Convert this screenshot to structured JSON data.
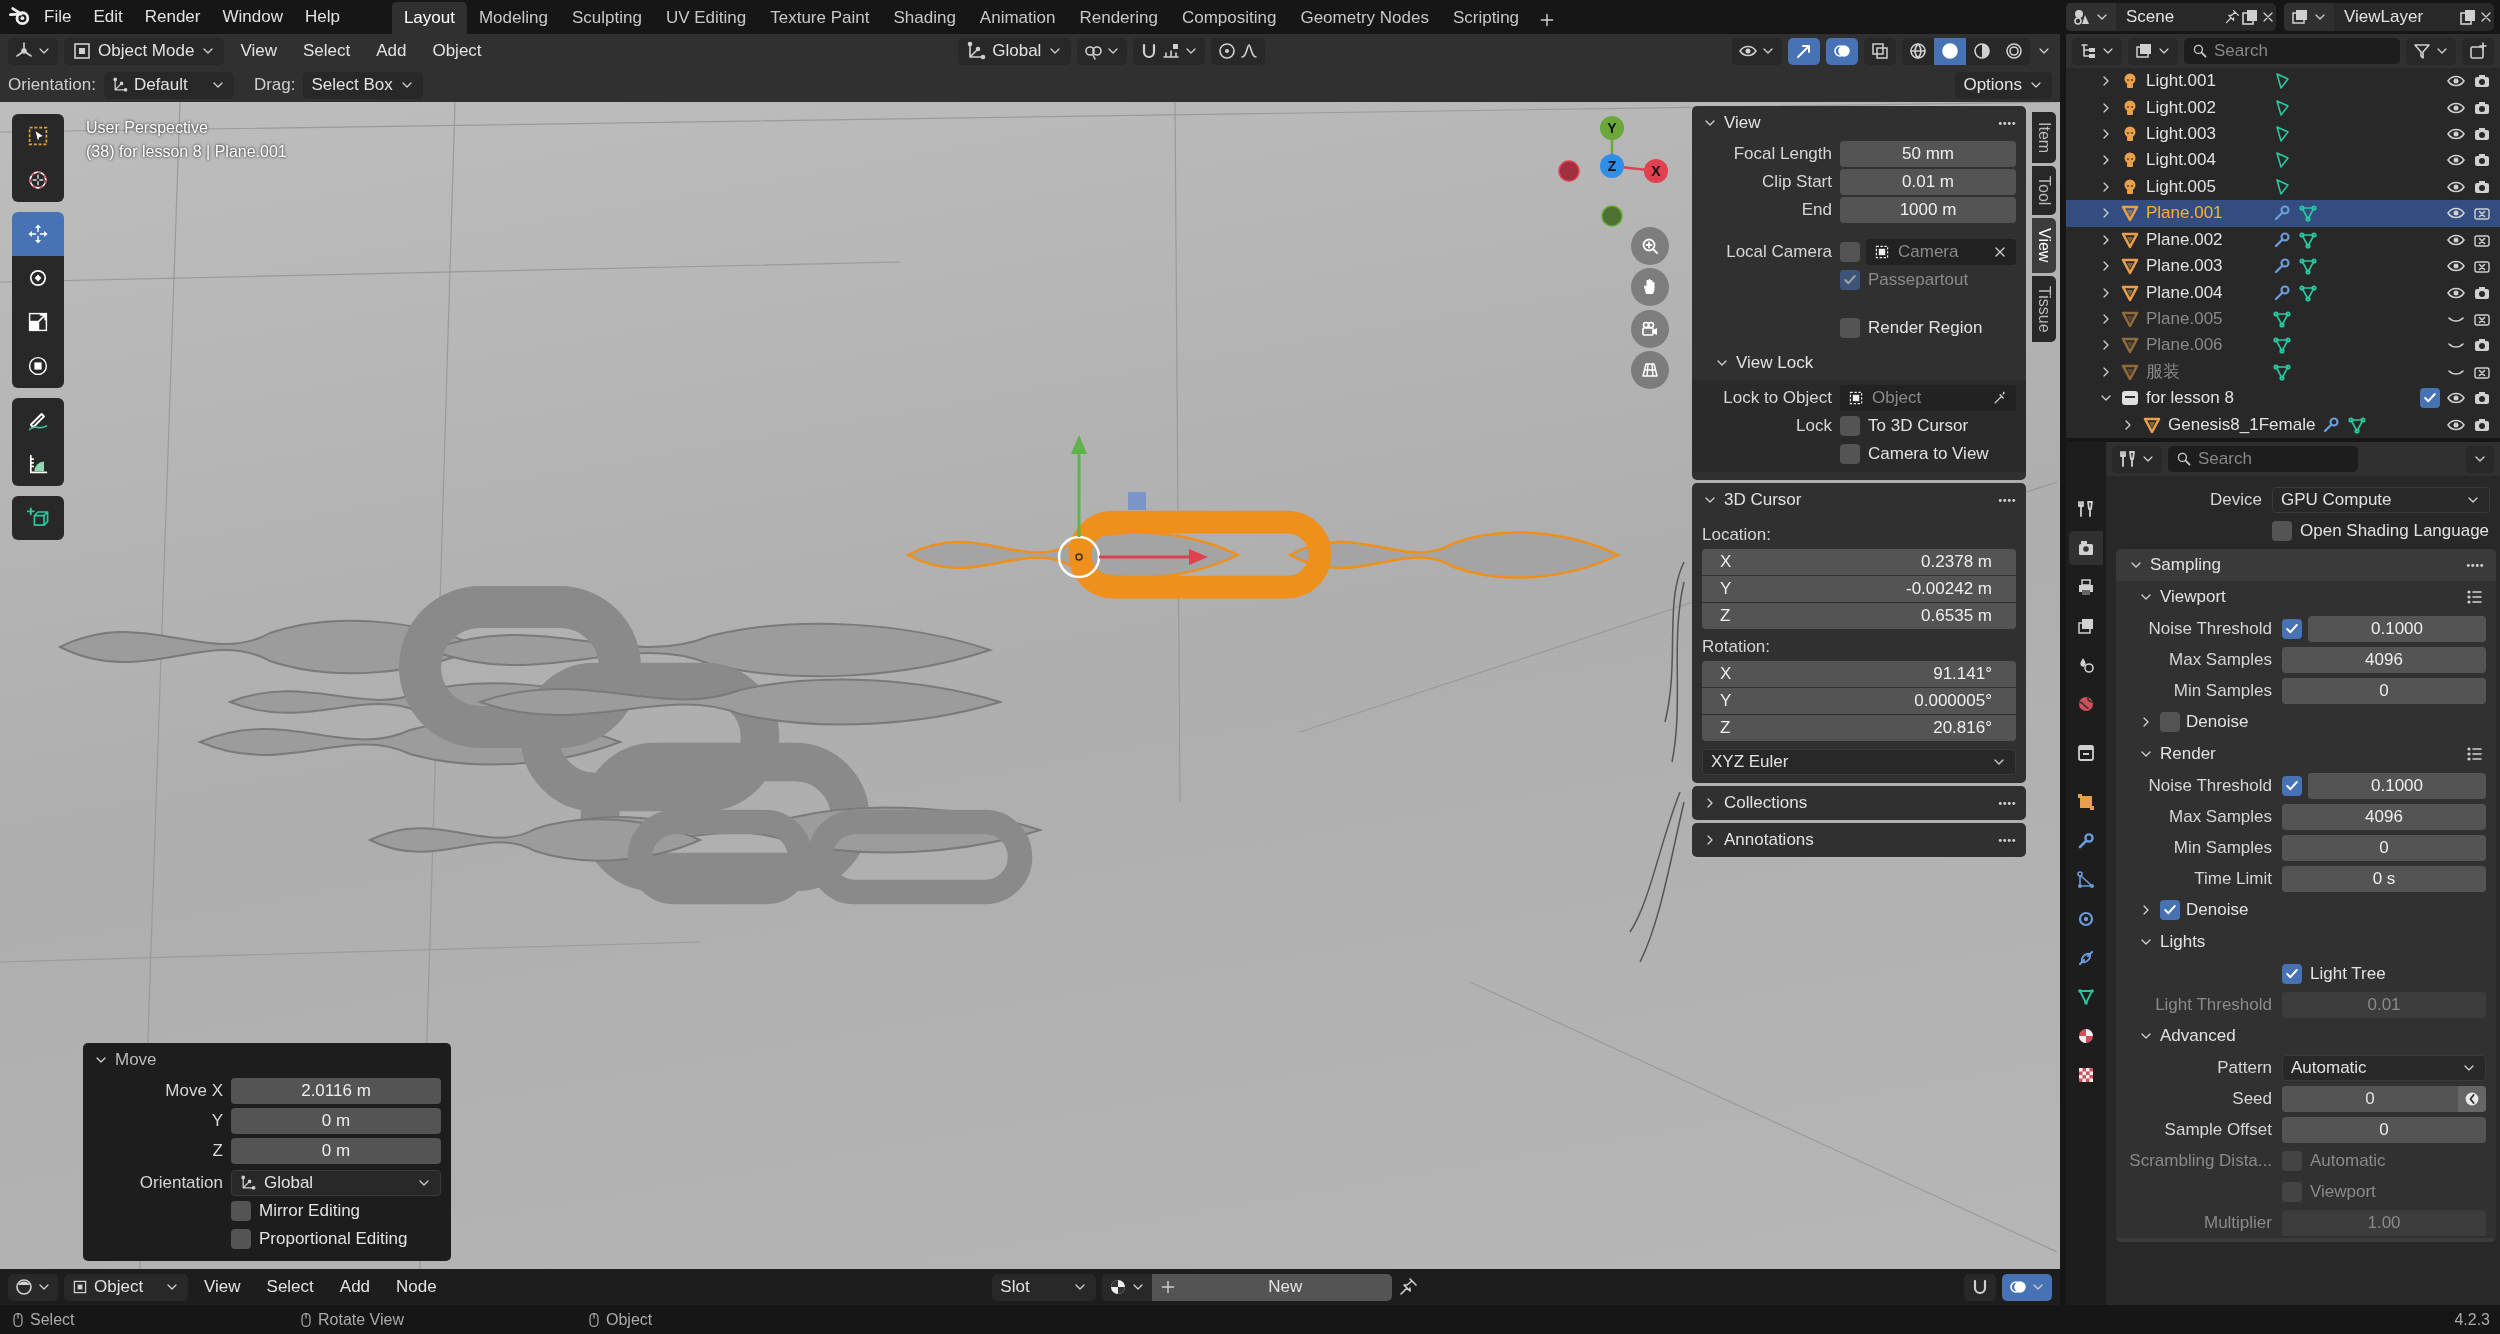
{
  "menu": [
    "File",
    "Edit",
    "Render",
    "Window",
    "Help"
  ],
  "workspaces": [
    {
      "label": "Layout",
      "selected": true
    },
    {
      "label": "Modeling",
      "selected": false
    },
    {
      "label": "Sculpting",
      "selected": false
    },
    {
      "label": "UV Editing",
      "selected": false
    },
    {
      "label": "Texture Paint",
      "selected": false
    },
    {
      "label": "Shading",
      "selected": false
    },
    {
      "label": "Animation",
      "selected": false
    },
    {
      "label": "Rendering",
      "selected": false
    },
    {
      "label": "Compositing",
      "selected": false
    },
    {
      "label": "Geometry Nodes",
      "selected": false
    },
    {
      "label": "Scripting",
      "selected": false
    }
  ],
  "scene": "Scene",
  "view_layer": "ViewLayer",
  "viewport_header": {
    "mode": "Object Mode",
    "menus": [
      "View",
      "Select",
      "Add",
      "Object"
    ],
    "orientation": "Global",
    "toggles": [
      {
        "kind": "gizmo",
        "on": true
      },
      {
        "kind": "overlay",
        "on": true
      },
      {
        "kind": "xray",
        "on": false
      }
    ],
    "shading": [
      {
        "kind": "wireframe",
        "selected": false
      },
      {
        "kind": "solid",
        "selected": true
      },
      {
        "kind": "material",
        "selected": false
      },
      {
        "kind": "rendered",
        "selected": false
      }
    ]
  },
  "tool_settings": {
    "orientation_label": "Orientation:",
    "orientation": "Default",
    "drag_label": "Drag:",
    "drag": "Select Box",
    "options": "Options"
  },
  "tools": [
    {
      "kind": "select_box",
      "selected": false
    },
    {
      "kind": "cursor",
      "selected": false
    },
    {
      "kind": "move",
      "selected": true
    },
    {
      "kind": "rotate",
      "selected": false
    },
    {
      "kind": "scale",
      "selected": false
    },
    {
      "kind": "transform",
      "selected": false
    },
    {
      "kind": "annotate",
      "selected": false
    },
    {
      "kind": "measure",
      "selected": false
    },
    {
      "kind": "add_cube",
      "selected": false
    }
  ],
  "viewport_info": [
    "User Perspective",
    "(38) for lesson 8 | Plane.001"
  ],
  "gizmo_axes": {
    "x": "X",
    "y": "Y",
    "z": "Z"
  },
  "sidebar_tabs": [
    {
      "label": "Item",
      "selected": false
    },
    {
      "label": "Tool",
      "selected": false
    },
    {
      "label": "View",
      "selected": true
    },
    {
      "label": "Tissue",
      "selected": false
    }
  ],
  "view_panel": {
    "title": "View",
    "fields": [
      {
        "label": "Focal Length",
        "value": "50 mm"
      },
      {
        "label": "Clip Start",
        "value": "0.01 m"
      },
      {
        "label": "End",
        "value": "1000 m"
      }
    ],
    "local_camera": {
      "label": "Local Camera",
      "checked": false,
      "placeholder": "Camera"
    },
    "passepartout": {
      "label": "Passepartout",
      "checked": true
    },
    "render_region": {
      "label": "Render Region",
      "checked": false
    },
    "view_lock": {
      "title": "View Lock",
      "lock_to_object_label": "Lock to Object",
      "lock_to_object_placeholder": "Object",
      "lock_label": "Lock",
      "options": [
        {
          "label": "To 3D Cursor",
          "checked": false
        },
        {
          "label": "Camera to View",
          "checked": false
        }
      ]
    }
  },
  "cursor_panel": {
    "title": "3D Cursor",
    "location_label": "Location:",
    "location": [
      {
        "axis": "X",
        "value": "0.2378 m"
      },
      {
        "axis": "Y",
        "value": "-0.00242 m"
      },
      {
        "axis": "Z",
        "value": "0.6535 m"
      }
    ],
    "rotation_label": "Rotation:",
    "rotation": [
      {
        "axis": "X",
        "value": "91.141°"
      },
      {
        "axis": "Y",
        "value": "0.000005°"
      },
      {
        "axis": "Z",
        "value": "20.816°"
      }
    ],
    "rotation_mode": "XYZ Euler"
  },
  "collapsed_panels": [
    "Collections",
    "Annotations"
  ],
  "redo_panel": {
    "title": "Move",
    "fields": [
      {
        "label": "Move X",
        "value": "2.0116 m"
      },
      {
        "label": "Y",
        "value": "0 m"
      },
      {
        "label": "Z",
        "value": "0 m"
      }
    ],
    "orientation_label": "Orientation",
    "orientation": "Global",
    "options": [
      {
        "label": "Mirror Editing",
        "checked": false
      },
      {
        "label": "Proportional Editing",
        "checked": false
      }
    ]
  },
  "editor_header": {
    "mode": "Object",
    "menus": [
      "View",
      "Select",
      "Add",
      "Node"
    ],
    "slot": "Slot",
    "new_button": "New",
    "overlay_on": true
  },
  "outliner": {
    "search_placeholder": "Search",
    "items": [
      {
        "name": "Light.001",
        "kind": "light",
        "expanded": false,
        "selected": false,
        "visible": true,
        "renderable": true,
        "modifier": false
      },
      {
        "name": "Light.002",
        "kind": "light",
        "expanded": false,
        "selected": false,
        "visible": true,
        "renderable": true,
        "modifier": false
      },
      {
        "name": "Light.003",
        "kind": "light",
        "expanded": false,
        "selected": false,
        "visible": true,
        "renderable": true,
        "modifier": false
      },
      {
        "name": "Light.004",
        "kind": "light",
        "expanded": false,
        "selected": false,
        "visible": true,
        "renderable": true,
        "modifier": false
      },
      {
        "name": "Light.005",
        "kind": "light",
        "expanded": false,
        "selected": false,
        "visible": true,
        "renderable": true,
        "modifier": false
      },
      {
        "name": "Plane.001",
        "kind": "mesh",
        "expanded": false,
        "selected": true,
        "visible": true,
        "renderable": false,
        "modifier": true
      },
      {
        "name": "Plane.002",
        "kind": "mesh",
        "expanded": false,
        "selected": false,
        "visible": true,
        "renderable": false,
        "modifier": true
      },
      {
        "name": "Plane.003",
        "kind": "mesh",
        "expanded": false,
        "selected": false,
        "visible": true,
        "renderable": false,
        "modifier": true
      },
      {
        "name": "Plane.004",
        "kind": "mesh",
        "expanded": false,
        "selected": false,
        "visible": true,
        "renderable": true,
        "modifier": true
      },
      {
        "name": "Plane.005",
        "kind": "mesh",
        "expanded": false,
        "selected": false,
        "visible": false,
        "renderable": false,
        "modifier": false
      },
      {
        "name": "Plane.006",
        "kind": "mesh",
        "expanded": false,
        "selected": false,
        "visible": false,
        "renderable": true,
        "modifier": false
      },
      {
        "name": "服装",
        "kind": "mesh",
        "expanded": false,
        "selected": false,
        "visible": false,
        "renderable": false,
        "modifier": false
      },
      {
        "name": "for lesson 8",
        "kind": "collection",
        "expanded": true,
        "selected": false,
        "visible": true,
        "renderable": true,
        "modifier": false,
        "checked": true,
        "children": [
          {
            "name": "Genesis8_1Female",
            "kind": "mesh",
            "expanded": false,
            "selected": false,
            "visible": true,
            "renderable": true,
            "modifier": true
          }
        ]
      }
    ]
  },
  "properties": {
    "search_placeholder": "Search",
    "tabs": [
      {
        "kind": "tool",
        "selected": false
      },
      {
        "kind": "render",
        "selected": true
      },
      {
        "kind": "output",
        "selected": false
      },
      {
        "kind": "view_layer",
        "selected": false
      },
      {
        "kind": "scene",
        "selected": false
      },
      {
        "kind": "world",
        "selected": false
      },
      {
        "kind": "collection",
        "selected": false
      },
      {
        "kind": "object",
        "selected": false
      },
      {
        "kind": "modifiers",
        "selected": false
      },
      {
        "kind": "particles",
        "selected": false
      },
      {
        "kind": "physics",
        "selected": false
      },
      {
        "kind": "constraints",
        "selected": false
      },
      {
        "kind": "data",
        "selected": false
      },
      {
        "kind": "material",
        "selected": false
      },
      {
        "kind": "texture",
        "selected": false
      }
    ],
    "rows": [
      {
        "kind": "dropdown",
        "label": "Device",
        "value": "GPU Compute"
      },
      {
        "kind": "checkbox",
        "text": "Open Shading Language",
        "checked": false,
        "disabled": false
      }
    ],
    "sections": [
      {
        "title": "Sampling",
        "expanded": true,
        "presets": false,
        "children": [
          {
            "title": "Viewport",
            "expanded": true,
            "presets": true,
            "rows": [
              {
                "kind": "check_number",
                "label": "Noise Threshold",
                "checked": true,
                "value": "0.1000"
              },
              {
                "kind": "number",
                "label": "Max Samples",
                "value": "4096",
                "disabled": false
              },
              {
                "kind": "number",
                "label": "Min Samples",
                "value": "0",
                "disabled": false
              }
            ],
            "children": [
              {
                "title": "Denoise",
                "expanded": false,
                "presets": false,
                "checked": false
              }
            ]
          },
          {
            "title": "Render",
            "expanded": true,
            "presets": true,
            "rows": [
              {
                "kind": "check_number",
                "label": "Noise Threshold",
                "checked": true,
                "value": "0.1000"
              },
              {
                "kind": "number",
                "label": "Max Samples",
                "value": "4096",
                "disabled": false
              },
              {
                "kind": "number",
                "label": "Min Samples",
                "value": "0",
                "disabled": false
              },
              {
                "kind": "number",
                "label": "Time Limit",
                "value": "0 s",
                "disabled": false
              }
            ],
            "children": [
              {
                "title": "Denoise",
                "expanded": false,
                "presets": false,
                "checked": true
              }
            ]
          },
          {
            "title": "Lights",
            "expanded": true,
            "presets": false,
            "rows": [
              {
                "kind": "checkbox",
                "text": "Light Tree",
                "checked": true,
                "disabled": false
              },
              {
                "kind": "number",
                "label": "Light Threshold",
                "value": "0.01",
                "disabled": true
              }
            ]
          },
          {
            "title": "Advanced",
            "expanded": true,
            "presets": false,
            "rows": [
              {
                "kind": "dropdown",
                "label": "Pattern",
                "value": "Automatic"
              },
              {
                "kind": "seed",
                "label": "Seed",
                "value": "0"
              },
              {
                "kind": "number",
                "label": "Sample Offset",
                "value": "0",
                "disabled": false
              },
              {
                "kind": "checkbox",
                "label": "Scrambling Dista...",
                "text": "Automatic",
                "checked": false,
                "disabled": true
              },
              {
                "kind": "checkbox",
                "text": "Viewport",
                "checked": false,
                "disabled": true
              },
              {
                "kind": "number",
                "label": "Multiplier",
                "value": "1.00",
                "disabled": true
              }
            ]
          }
        ]
      }
    ]
  },
  "status_bar": {
    "items": [
      "Select",
      "Rotate View",
      "Object"
    ],
    "version": "4.2.3"
  }
}
